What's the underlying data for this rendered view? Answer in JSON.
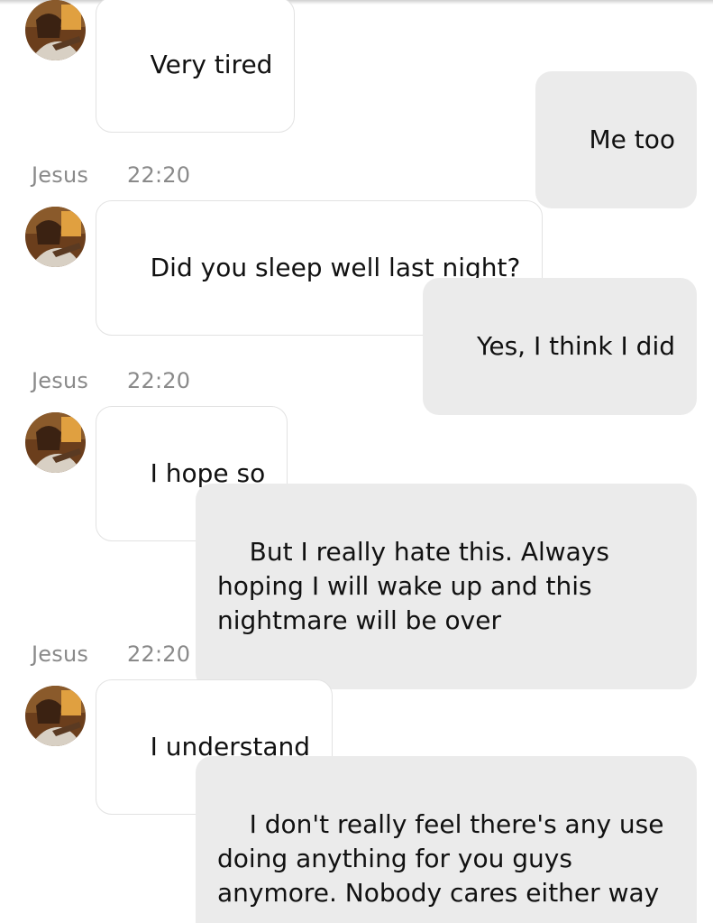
{
  "contact": {
    "name": "Jesus"
  },
  "messages": [
    {
      "from": "contact",
      "text": "Very tired"
    },
    {
      "from": "me",
      "text": "Me too"
    },
    {
      "from": "contact",
      "time": "22:20",
      "text": "Did you sleep well last night?"
    },
    {
      "from": "me",
      "text": "Yes, I think I did"
    },
    {
      "from": "contact",
      "time": "22:20",
      "text": "I hope so"
    },
    {
      "from": "me",
      "text": "But I really hate this. Always hoping I will wake up and this nightmare will be over"
    },
    {
      "from": "contact",
      "time": "22:20",
      "text": "I understand"
    },
    {
      "from": "me",
      "text": "I don't really feel there's any use doing anything for you guys anymore. Nobody cares either way"
    }
  ]
}
